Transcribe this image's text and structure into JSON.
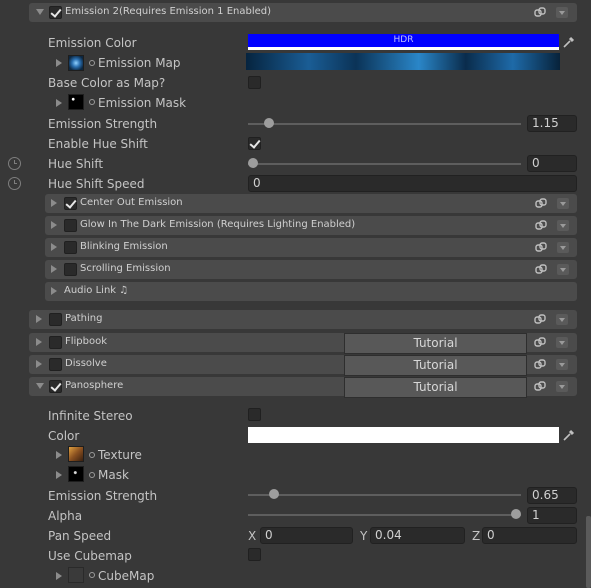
{
  "emission2": {
    "header": "Emission 2(Requires Emission 1 Enabled)",
    "checked": true,
    "emission_color_label": "Emission Color",
    "emission_color_hdr": "HDR",
    "emission_color_hex": "#0000ff",
    "emission_map_label": "Emission Map",
    "base_color_as_map_label": "Base Color as Map?",
    "base_color_as_map_checked": false,
    "emission_mask_label": "Emission Mask",
    "emission_strength_label": "Emission Strength",
    "emission_strength_value": "1.15",
    "emission_strength_fraction": 0.06,
    "enable_hue_shift_label": "Enable Hue Shift",
    "enable_hue_shift_checked": true,
    "hue_shift_label": "Hue Shift",
    "hue_shift_value": "0",
    "hue_shift_fraction": 0.0,
    "hue_shift_speed_label": "Hue Shift Speed",
    "hue_shift_speed_value": "0",
    "subsections": [
      {
        "label": "Center Out Emission",
        "checked": true
      },
      {
        "label": "Glow In The Dark Emission (Requires Lighting Enabled)",
        "checked": false
      },
      {
        "label": "Blinking Emission",
        "checked": false
      },
      {
        "label": "Scrolling Emission",
        "checked": false
      }
    ],
    "audio_link_label": "Audio Link ♫"
  },
  "sections": [
    {
      "label": "Pathing",
      "checked": false,
      "tutorial": ""
    },
    {
      "label": "Flipbook",
      "checked": false,
      "tutorial": "Tutorial"
    },
    {
      "label": "Dissolve",
      "checked": false,
      "tutorial": "Tutorial"
    },
    {
      "label": "Panosphere",
      "checked": true,
      "tutorial": "Tutorial"
    }
  ],
  "panosphere": {
    "infinite_stereo_label": "Infinite Stereo",
    "infinite_stereo_checked": false,
    "color_label": "Color",
    "color_hex": "#ffffff",
    "texture_label": "Texture",
    "mask_label": "Mask",
    "emission_strength_label": "Emission Strength",
    "emission_strength_value": "0.65",
    "emission_strength_fraction": 0.08,
    "alpha_label": "Alpha",
    "alpha_value": "1",
    "alpha_fraction": 1.0,
    "pan_speed_label": "Pan Speed",
    "pan_x_label": "X",
    "pan_x_value": "0",
    "pan_y_label": "Y",
    "pan_y_value": "0.04",
    "pan_z_label": "Z",
    "pan_z_value": "0",
    "use_cubemap_label": "Use Cubemap",
    "use_cubemap_checked": false,
    "cubemap_label": "CubeMap"
  },
  "colors": {
    "panel_bg": "#383838",
    "header_bg": "#4b4b4b",
    "field_bg": "#2a2a2a",
    "emission_color": "#0000ff",
    "pano_color": "#ffffff"
  }
}
